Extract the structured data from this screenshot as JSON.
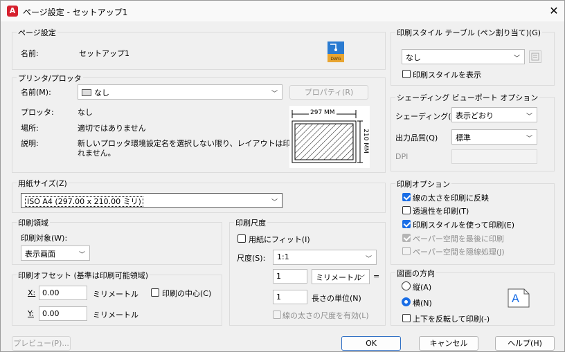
{
  "title": "ページ設定 - セットアップ1",
  "page_setup": {
    "group": "ページ設定",
    "name_label": "名前:",
    "name_value": "セットアップ1",
    "dwg_label": "DWG"
  },
  "printer": {
    "group": "プリンタ/プロッタ",
    "name_label": "名前(M):",
    "name_value": "なし",
    "properties_button": "プロパティ(R)",
    "plotter_label": "プロッタ:",
    "plotter_value": "なし",
    "location_label": "場所:",
    "location_value": "適切ではありません",
    "description_label": "説明:",
    "description_value_1": "新しいプロッタ環境設定名を選択しない限り、レイアウトは印刷さ",
    "description_value_2": "れません。",
    "preview_width": "297 MM",
    "preview_height": "210 MM"
  },
  "paper_size": {
    "group": "用紙サイズ(Z)",
    "value": "ISO A4 (297.00 x 210.00 ミリ)"
  },
  "plot_area": {
    "group": "印刷領域",
    "target_label": "印刷対象(W):",
    "target_value": "表示画面"
  },
  "plot_offset": {
    "group": "印刷オフセット (基準は印刷可能領域)",
    "x_label": "X:",
    "x_value": "0.00",
    "x_unit": "ミリメートル",
    "y_label": "Y:",
    "y_value": "0.00",
    "y_unit": "ミリメートル",
    "center_label": "印刷の中心(C)"
  },
  "plot_scale": {
    "group": "印刷尺度",
    "fit_label": "用紙にフィット(I)",
    "scale_label": "尺度(S):",
    "scale_value": "1:1",
    "value1": "1",
    "unit_value": "ミリメートル",
    "equals": "=",
    "value2": "1",
    "unit2_label": "長さの単位(N)",
    "lineweight_label": "線の太さの尺度を有効(L)"
  },
  "plot_style": {
    "group": "印刷スタイル テーブル (ペン割り当て)(G)",
    "value": "なし",
    "show_label": "印刷スタイルを表示"
  },
  "shaded": {
    "group": "シェーディング ビューポート オプション",
    "shade_label": "シェーディング(D)",
    "shade_value": "表示どおり",
    "quality_label": "出力品質(Q)",
    "quality_value": "標準",
    "dpi_label": "DPI"
  },
  "plot_options": {
    "group": "印刷オプション",
    "items": [
      {
        "label": "線の太さを印刷に反映"
      },
      {
        "label": "透過性を印刷(T)"
      },
      {
        "label": "印刷スタイルを使って印刷(E)"
      },
      {
        "label": "ペーパー空間を最後に印刷"
      },
      {
        "label": "ペーパー空間を隠線処理(J)"
      }
    ]
  },
  "orientation": {
    "group": "図面の方向",
    "portrait_label": "縦(A)",
    "landscape_label": "横(N)",
    "upside_label": "上下を反転して印刷(-)",
    "icon_letter": "A"
  },
  "buttons": {
    "preview": "プレビュー(P)...",
    "ok": "OK",
    "cancel": "キャンセル",
    "help": "ヘルプ(H)"
  },
  "colors": {
    "accent": "#1a6ee6",
    "app_icon": "#d6202e"
  }
}
